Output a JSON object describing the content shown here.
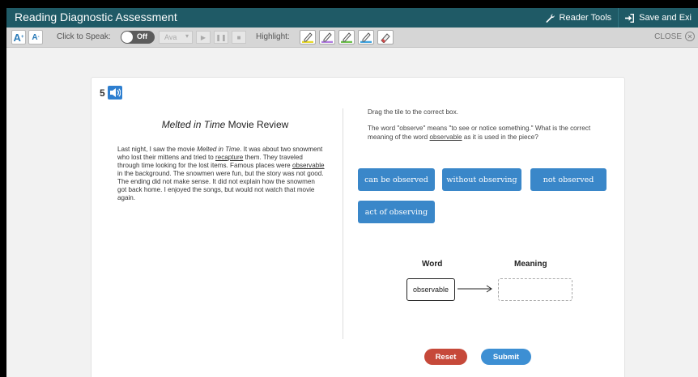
{
  "app": {
    "title": "Reading Diagnostic Assessment"
  },
  "header": {
    "reader_tools": "Reader Tools",
    "save_exit": "Save and Exi"
  },
  "toolbar": {
    "font_increase": "A",
    "font_decrease": "A",
    "click_to_speak": "Click to Speak:",
    "toggle_state": "Off",
    "voice": "Ava",
    "highlight": "Highlight:",
    "highlight_colors": [
      "#e6d82a",
      "#b07be0",
      "#6cc04a",
      "#3ea3e0",
      "#d04a4a"
    ],
    "close": "CLOSE"
  },
  "question": {
    "number": "5",
    "passage_title_italic": "Melted in Time",
    "passage_title_rest": " Movie Review",
    "passage": {
      "p1": "Last night, I saw the movie ",
      "p2": "Melted in Time",
      "p3": ". It was about two snowment who lost their mittens and tried to ",
      "p4": "recapture",
      "p5": " them. They traveled through time looking for the lost items. Famous places were ",
      "p6": "observable",
      "p7": " in the background. The snowmen were fun, but the story was not good. The ending did not make sense. It did not explain how the snowmen got back home. I enjoyed the songs, but would not watch that movie again."
    },
    "instruction": "Drag the tile to the correct box.",
    "prompt_a": "The word \"observe\" means \"to see or notice something.\" What is the correct meaning of the word ",
    "prompt_word": "observable",
    "prompt_b": " as it is used in the piece?",
    "tiles": [
      "can be observed",
      "without observing",
      "not observed",
      "act of observing"
    ],
    "word_header": "Word",
    "meaning_header": "Meaning",
    "word_value": "observable",
    "reset": "Reset",
    "submit": "Submit"
  }
}
